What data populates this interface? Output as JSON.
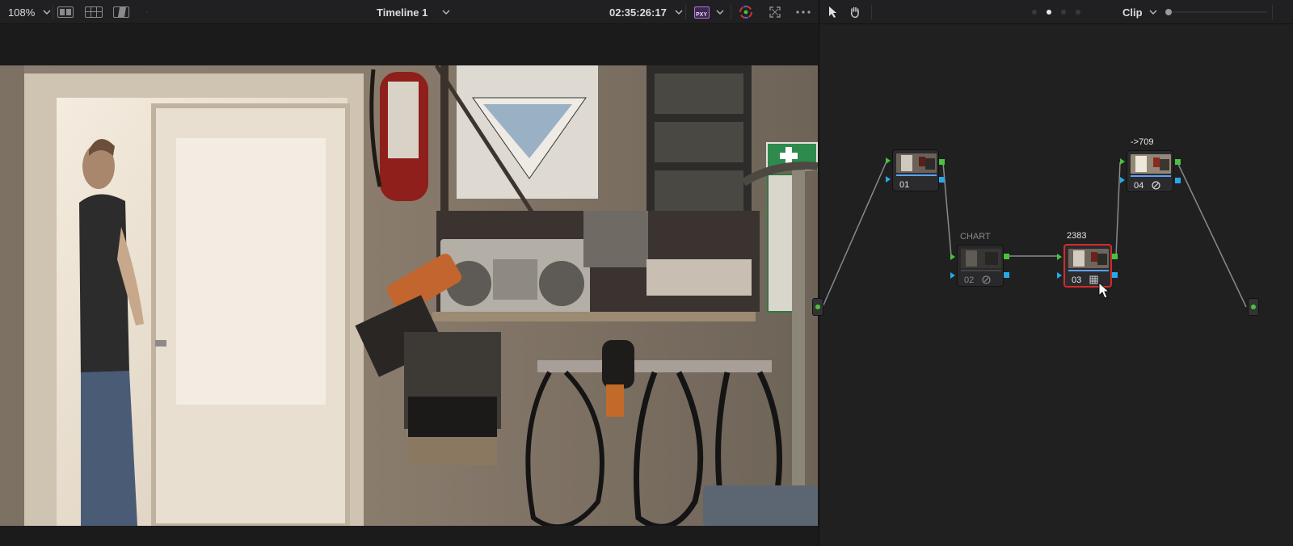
{
  "viewer": {
    "zoom": "108%",
    "timeline_name": "Timeline 1",
    "timecode": "02:35:26:17",
    "proxy_badge": "PXY"
  },
  "node_editor": {
    "mode_label": "Clip",
    "nodes": [
      {
        "number": "01",
        "label": "",
        "badge": ""
      },
      {
        "number": "02",
        "label": "CHART",
        "badge": "adjust-icon"
      },
      {
        "number": "03",
        "label": "2383",
        "badge": "grid-icon"
      },
      {
        "number": "04",
        "label": "->709",
        "badge": "adjust-icon"
      }
    ]
  },
  "colors": {
    "accent_green": "#4bc23c",
    "accent_blue": "#29a8e8",
    "selected_node": "#d42a2a"
  }
}
